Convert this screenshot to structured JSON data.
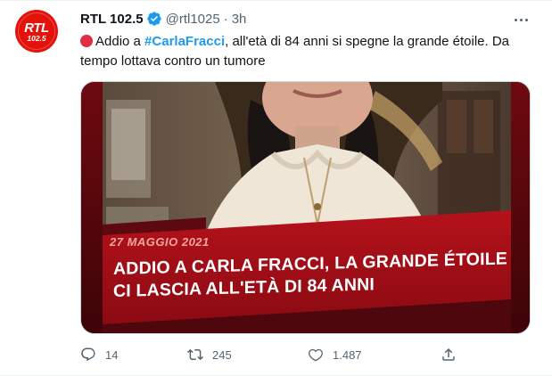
{
  "tweet": {
    "display_name": "RTL 102.5",
    "handle": "@rtl1025",
    "separator": "·",
    "time": "3h",
    "avatar_text_top": "RTL",
    "avatar_text_bottom": "102.5",
    "text_prefix": "Addio a ",
    "hashtag": "#CarlaFracci",
    "text_rest": ", all'età di 84 anni si spegne la grande étoile. Da tempo lottava contro un tumore"
  },
  "media": {
    "date_text": "27 MAGGIO 2021",
    "headline": "ADDIO A CARLA FRACCI, LA GRANDE ÉTOILE CI LASCIA ALL'ETÀ DI 84 ANNI"
  },
  "actions": {
    "replies": "14",
    "retweets": "245",
    "likes": "1.487"
  },
  "colors": {
    "accent": "#1d9bf0",
    "muted": "#536471",
    "brand_red": "#e3120b",
    "banner_red": "#b5121b"
  },
  "icons": [
    "verified-icon",
    "more-icon",
    "red-circle-icon",
    "reply-icon",
    "retweet-icon",
    "like-icon",
    "share-icon"
  ]
}
